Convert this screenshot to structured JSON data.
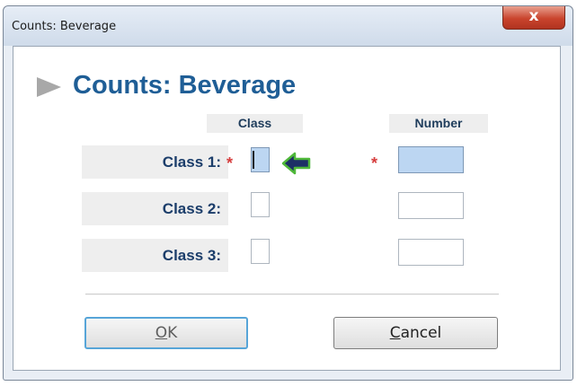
{
  "window": {
    "title": "Counts: Beverage",
    "close_glyph": "x"
  },
  "heading": {
    "icon": "right-arrow-icon",
    "text": "Counts: Beverage"
  },
  "columns": {
    "class_header": "Class",
    "number_header": "Number"
  },
  "rows": [
    {
      "label": "Class 1:",
      "required": "*",
      "class_value": "",
      "number_value": "",
      "active": true
    },
    {
      "label": "Class 2:",
      "required": "",
      "class_value": "",
      "number_value": "",
      "active": false
    },
    {
      "label": "Class 3:",
      "required": "",
      "class_value": "",
      "number_value": "",
      "active": false
    }
  ],
  "number_required_mark": "*",
  "pointer_icon": "left-arrow-pointer-icon",
  "buttons": {
    "ok_mnemonic": "O",
    "ok_rest": "K",
    "cancel_mnemonic": "C",
    "cancel_rest": "ancel"
  },
  "colors": {
    "heading": "#1f5e96",
    "label": "#1b3d6a",
    "required": "#d63d3d",
    "active_field": "#bcd6f2",
    "close_button": "#c9442d"
  }
}
